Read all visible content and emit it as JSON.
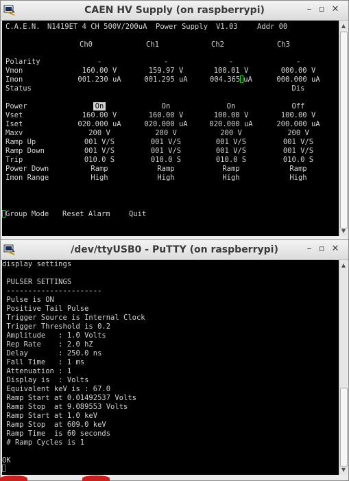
{
  "window1": {
    "title": "CAEN HV Supply (on raspberrypi)",
    "header": {
      "brand": "C.A.E.N.",
      "model": "N1419ET 4 CH 500V/200uA  Power Supply",
      "version": "V1.03",
      "addr": "Addr 00"
    },
    "channels": [
      "Ch0",
      "Ch1",
      "Ch2",
      "Ch3"
    ],
    "rows": [
      {
        "label": "Polarity",
        "values": [
          "-",
          "-",
          "-",
          "-"
        ]
      },
      {
        "label": "Vmon",
        "values": [
          "160.00 V",
          "159.97 V",
          "100.01 V",
          "000.00 V"
        ]
      },
      {
        "label": "Imon",
        "values": [
          "001.230 uA",
          "001.295 uA",
          "004.365 uA",
          "000.000 uA"
        ]
      },
      {
        "label": "Status",
        "values": [
          "",
          "",
          "",
          "Dis"
        ]
      },
      {
        "label": "Power",
        "values": [
          "On",
          "On",
          "On",
          "Off"
        ]
      },
      {
        "label": "Vset",
        "values": [
          "160.00 V",
          "160.00 V",
          "100.00 V",
          "100.00 V"
        ]
      },
      {
        "label": "Iset",
        "values": [
          "020.000 uA",
          "020.000 uA",
          "020.000 uA",
          "200.000 uA"
        ]
      },
      {
        "label": "Maxv",
        "values": [
          "200 V",
          "200 V",
          "200 V",
          "200 V"
        ]
      },
      {
        "label": "Ramp Up",
        "values": [
          "001 V/S",
          "001 V/S",
          "001 V/S",
          "001 V/S"
        ]
      },
      {
        "label": "Ramp Down",
        "values": [
          "001 V/S",
          "001 V/S",
          "001 V/S",
          "001 V/S"
        ]
      },
      {
        "label": "Trip",
        "values": [
          "010.0 S",
          "010.0 S",
          "010.0 S",
          "010.0 S"
        ]
      },
      {
        "label": "Power Down",
        "values": [
          "Ramp",
          "Ramp",
          "Ramp",
          "Ramp"
        ]
      },
      {
        "label": "Imon Range",
        "values": [
          "High",
          "High",
          "High",
          "High"
        ]
      }
    ],
    "actions": [
      "Group Mode",
      "Reset Alarm",
      "Quit"
    ],
    "imon_ch2_prefix": "004.365",
    "imon_ch2_suffix": "uA"
  },
  "window2": {
    "title": "/dev/ttyUSB0 - PuTTY (on raspberrypi)",
    "lines": [
      "display settings",
      "",
      " PULSER SETTINGS",
      " ----------------------",
      " Pulse is ON",
      " Positive Tail Pulse",
      " Trigger Source is Internal Clock",
      " Trigger Threshold is 0.2",
      " Amplitude   : 1.0 Volts",
      " Rep Rate    : 2.0 hZ",
      " Delay       : 250.0 ns",
      " Fall Time   : 1 ms",
      " Attenuation : 1",
      " Display is  : Volts",
      " Equivalent keV is : 67.0",
      " Ramp Start at 0.01492537 Volts",
      " Ramp Stop  at 9.089553 Volts",
      " Ramp Start at 1.0 keV",
      " Ramp Stop  at 609.0 keV",
      " Ramp Time  is 60 seconds",
      " # Ramp Cycles is 1",
      "",
      "OK"
    ]
  },
  "colors": {
    "terminal_bg": "#000000",
    "terminal_fg": "#d3d3d3",
    "cursor": "#25d325",
    "titlebar": "#e4e4e4"
  },
  "icons": {
    "app": "putty-icon",
    "minimize": "minimize-icon",
    "maximize": "maximize-icon",
    "close": "close-icon"
  }
}
